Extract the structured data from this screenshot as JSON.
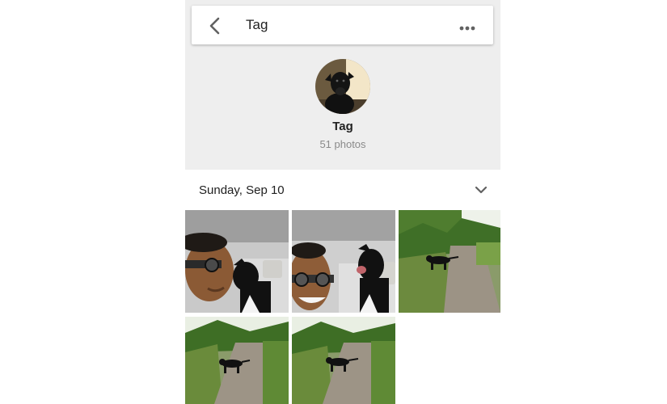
{
  "toolbar": {
    "title": "Tag",
    "back_icon": "chevron-left-icon",
    "more_icon": "more-horizontal-icon"
  },
  "profile": {
    "name": "Tag",
    "photo_count": "51 photos"
  },
  "section": {
    "date": "Sunday, Sep 10",
    "collapse_icon": "chevron-down-icon"
  },
  "photos": [
    {
      "subject": "selfie with dog in car"
    },
    {
      "subject": "selfie with dog in car smiling"
    },
    {
      "subject": "dog on forest path"
    },
    {
      "subject": "dog on forest path"
    },
    {
      "subject": "dog on forest path"
    }
  ],
  "colors": {
    "header_bg": "#eeeeee",
    "text_primary": "#212121",
    "text_secondary": "#8a8a8a"
  }
}
